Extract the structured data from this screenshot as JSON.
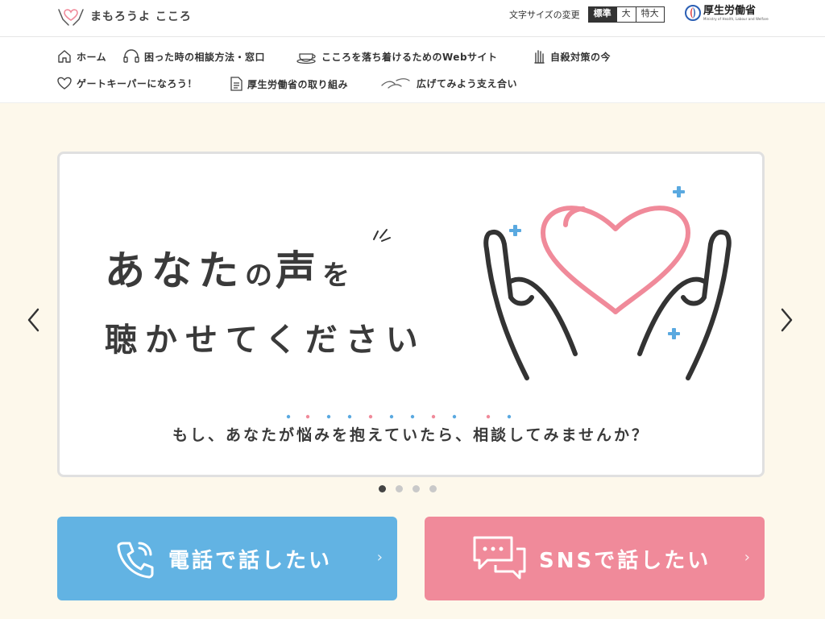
{
  "header": {
    "logo_text": "まもろうよ こころ",
    "font_size_label": "文字サイズの変更",
    "font_sizes": [
      "標準",
      "大",
      "特大"
    ],
    "ministry_name": "厚生労働省",
    "ministry_sub": "Ministry of Health, Labour and Welfare"
  },
  "nav": {
    "items": [
      {
        "label": "ホーム",
        "icon": "home-icon"
      },
      {
        "label": "困った時の相談方法・窓口",
        "icon": "headset-icon"
      },
      {
        "label": "こころを落ち着けるためのWebサイト",
        "icon": "teacup-icon"
      },
      {
        "label": "自殺対策の今",
        "icon": "hand-icon"
      },
      {
        "label": "ゲートキーパーになろう！",
        "icon": "heart-icon"
      },
      {
        "label": "厚生労働省の取り組み",
        "icon": "document-icon"
      },
      {
        "label": "広げてみよう支え合い",
        "icon": "hands-icon"
      }
    ]
  },
  "hero": {
    "title_a": "あなた",
    "title_b": "の",
    "title_c": "声",
    "title_d": "を",
    "title_line2": "聴かせてください",
    "subtitle": "もし、あなたが悩みを抱えていたら、相談してみませんか？"
  },
  "carousel": {
    "slides": 4,
    "active": 1
  },
  "cta": {
    "tel_label": "電話で話したい",
    "sns_label": "SNSで話したい",
    "chevron": "›"
  },
  "colors": {
    "tel": "#62b3e3",
    "sns": "#f08a9a",
    "background": "#fdf8eb",
    "heart": "#f08a9a",
    "sparkle": "#5aa9e0"
  }
}
